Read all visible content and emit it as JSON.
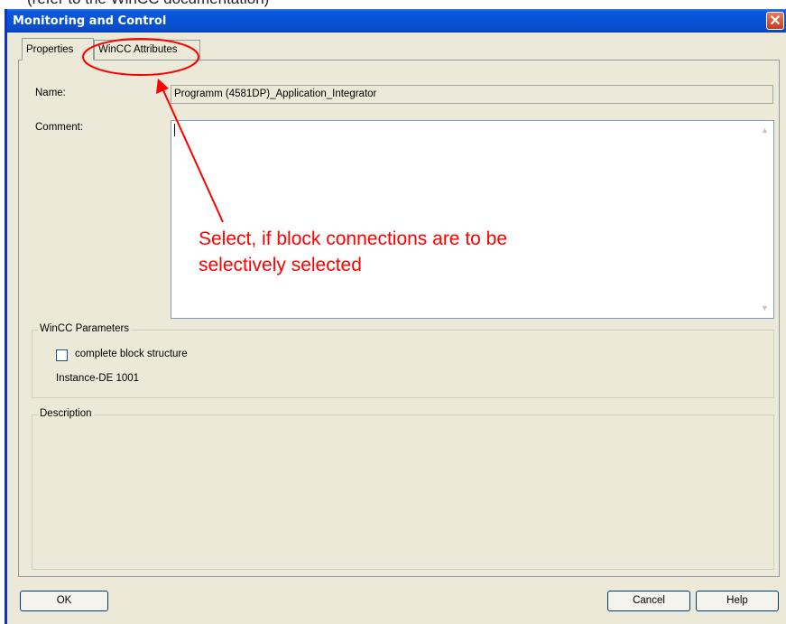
{
  "top_caption": "(refer to the WinCC documentation)",
  "window": {
    "title": "Monitoring and Control",
    "close_glyph": "✕"
  },
  "tabs": [
    {
      "label": "Properties",
      "active": true
    },
    {
      "label": "WinCC Attributes",
      "active": false
    }
  ],
  "form": {
    "name_label": "Name:",
    "name_value": "Programm (4581DP)_Application_Integrator",
    "comment_label": "Comment:",
    "comment_value": ""
  },
  "wincc_parameters": {
    "legend": "WinCC Parameters",
    "checkbox_label": "complete block structure",
    "checkbox_checked": false,
    "instance_text": "Instance-DE 1001"
  },
  "description": {
    "legend": "Description"
  },
  "buttons": {
    "ok": "OK",
    "cancel": "Cancel",
    "help": "Help"
  },
  "annotation": {
    "line1": "Select, if block connections are to be",
    "line2": "selectively selected",
    "color": "#ff0000"
  },
  "colors": {
    "titlebar": "#0752d6",
    "dialog_bg": "#ece9d8"
  }
}
